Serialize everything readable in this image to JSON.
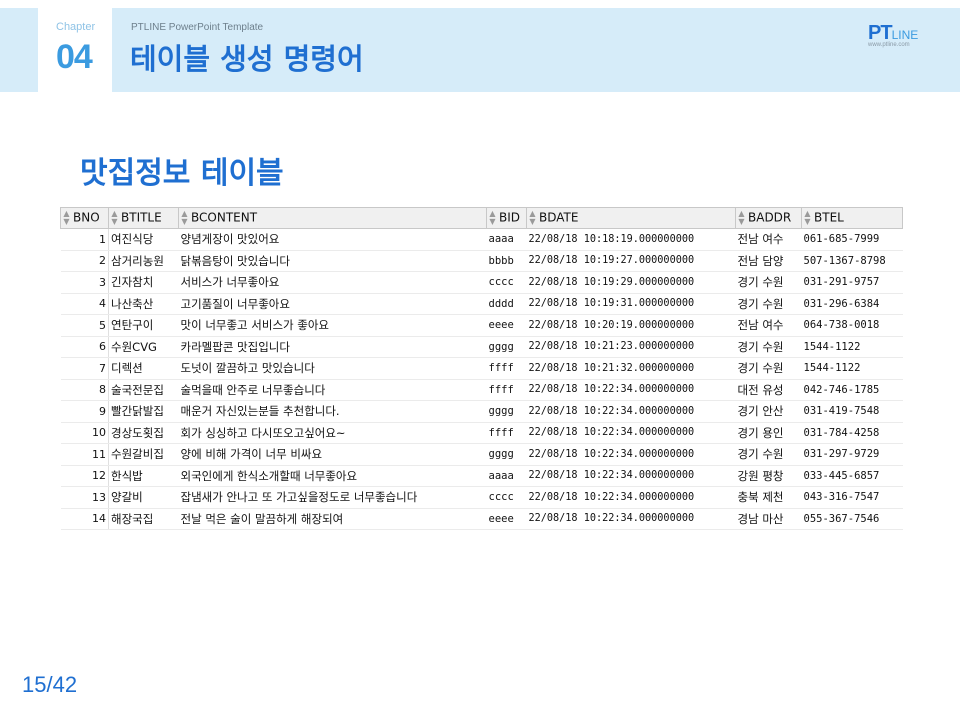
{
  "header": {
    "chapter_label": "Chapter",
    "chapter_number": "04",
    "template_label": "PTLINE PowerPoint Template",
    "title": "테이블 생성 명령어",
    "logo_text_bold": "PT",
    "logo_text_light": "LINE",
    "logo_url": "www.ptline.com"
  },
  "section_title": "맛집정보 테이블",
  "table": {
    "columns": [
      "BNO",
      "BTITLE",
      "BCONTENT",
      "BID",
      "BDATE",
      "BADDR",
      "BTEL"
    ],
    "rows": [
      [
        "1",
        "여진식당",
        "양념게장이 맛있어요",
        "aaaa",
        "22/08/18 10:18:19.000000000",
        "전남 여수",
        "061-685-7999"
      ],
      [
        "2",
        "삼거리농원",
        "닭볶음탕이 맛있습니다",
        "bbbb",
        "22/08/18 10:19:27.000000000",
        "전남 담양",
        "507-1367-8798"
      ],
      [
        "3",
        "긴자참치",
        "서비스가 너무좋아요",
        "cccc",
        "22/08/18 10:19:29.000000000",
        "경기 수원",
        "031-291-9757"
      ],
      [
        "4",
        "나산축산",
        "고기품질이 너무좋아요",
        "dddd",
        "22/08/18 10:19:31.000000000",
        "경기 수원",
        "031-296-6384"
      ],
      [
        "5",
        "연탄구이",
        "맛이 너무좋고 서비스가 좋아요",
        "eeee",
        "22/08/18 10:20:19.000000000",
        "전남 여수",
        "064-738-0018"
      ],
      [
        "6",
        "수원CVG",
        "카라멜팝콘 맛집입니다",
        "gggg",
        "22/08/18 10:21:23.000000000",
        "경기 수원",
        "1544-1122"
      ],
      [
        "7",
        "디렉션",
        "도넛이 깔끔하고 맛있습니다",
        "ffff",
        "22/08/18 10:21:32.000000000",
        "경기 수원",
        "1544-1122"
      ],
      [
        "8",
        "술국전문집",
        "술먹을때 안주로 너무좋습니다",
        "ffff",
        "22/08/18 10:22:34.000000000",
        "대전 유성",
        "042-746-1785"
      ],
      [
        "9",
        "빨간닭발집",
        "매운거 자신있는분들 추천합니다.",
        "gggg",
        "22/08/18 10:22:34.000000000",
        "경기 안산",
        "031-419-7548"
      ],
      [
        "10",
        "경상도횟집",
        "회가 싱싱하고 다시또오고싶어요~",
        "ffff",
        "22/08/18 10:22:34.000000000",
        "경기 용인",
        "031-784-4258"
      ],
      [
        "11",
        "수원갈비집",
        "양에 비해 가격이 너무 비싸요",
        "gggg",
        "22/08/18 10:22:34.000000000",
        "경기 수원",
        "031-297-9729"
      ],
      [
        "12",
        "한식밥",
        "외국인에게 한식소개할때 너무좋아요",
        "aaaa",
        "22/08/18 10:22:34.000000000",
        "강원 평창",
        "033-445-6857"
      ],
      [
        "13",
        "양갈비",
        "잡냄새가 안나고 또 가고싶을정도로 너무좋습니다",
        "cccc",
        "22/08/18 10:22:34.000000000",
        "충북 제천",
        "043-316-7547"
      ],
      [
        "14",
        "해장국집",
        "전날 먹은 술이 말끔하게 해장되여",
        "eeee",
        "22/08/18 10:22:34.000000000",
        "경남 마산",
        "055-367-7546"
      ]
    ]
  },
  "icons": {
    "sort": "sort-arrows-icon"
  },
  "colors": {
    "accent": "#1f6fd1",
    "header_band": "#d6ecf9"
  },
  "page_number": "15/42"
}
